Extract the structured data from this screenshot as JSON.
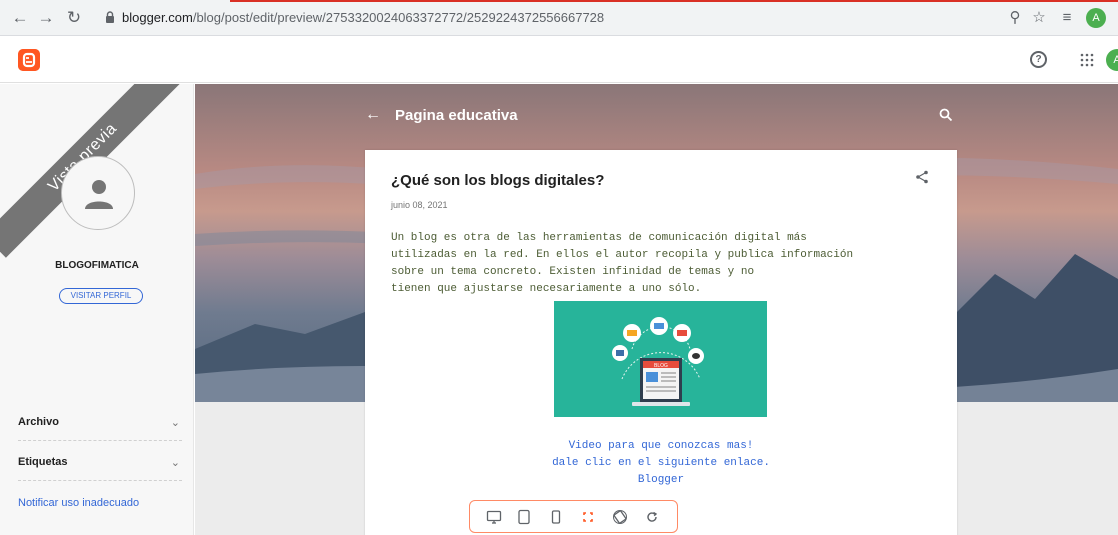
{
  "browser": {
    "url_host": "blogger.com",
    "url_path": "/blog/post/edit/preview/2753320024063372772/2529224372556667728",
    "profile_initial": "A"
  },
  "blogger": {
    "account_initial": "A"
  },
  "sidebar": {
    "ribbon_text": "Vista previa",
    "profile_name": "BLOGOFIMATICA",
    "visit_profile_label": "VISITAR PERFIL",
    "sections": [
      {
        "label": "Archivo"
      },
      {
        "label": "Etiquetas"
      }
    ],
    "report_link": "Notificar uso inadecuado"
  },
  "blog": {
    "title": "Pagina educativa"
  },
  "post": {
    "title": "¿Qué son los blogs digitales?",
    "date": "junio 08, 2021",
    "body": " Un blog es otra de las herramientas de comunicación digital más\nutilizadas en la red. En ellos el autor recopila y publica información\nsobre un tema concreto. Existen infinidad de temas y no\ntienen que ajustarse necesariamente a uno sólo.",
    "image_caption": "BLOG",
    "links": [
      "Video para que conozcas mas!",
      "dale clic en el siguiente enlace.",
      "Blogger"
    ]
  },
  "colors": {
    "accent": "#ff5722",
    "link": "#3367d6",
    "image_bg": "#27b49a",
    "body_text": "#4c5c34"
  }
}
